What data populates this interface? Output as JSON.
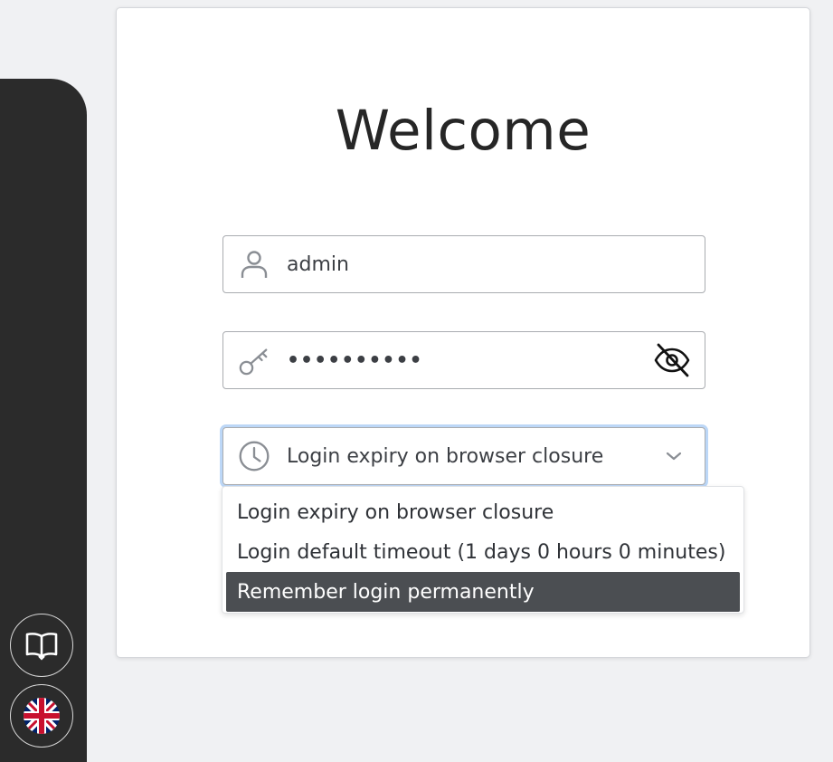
{
  "login": {
    "title": "Welcome",
    "username": {
      "value": "admin",
      "icon": "user-icon"
    },
    "password": {
      "value": "••••••••••",
      "icon": "key-icon",
      "toggle_icon": "eye-off-icon"
    },
    "expiry": {
      "selected_label": "Login expiry on browser closure",
      "icon": "clock-icon",
      "options": [
        "Login expiry on browser closure",
        "Login default timeout (1 days 0 hours 0 minutes)",
        "Remember login permanently"
      ],
      "highlighted_index": 2
    }
  },
  "sidebar": {
    "items": [
      {
        "icon": "book-icon"
      },
      {
        "icon": "uk-flag-icon"
      }
    ]
  },
  "colors": {
    "sidebar_bg": "#2b2b2b",
    "page_bg": "#f0f1f3",
    "focus_ring": "#bcd7f7",
    "option_highlight": "#4b4e52",
    "flag_blue": "#012169",
    "flag_red": "#c8102e"
  }
}
